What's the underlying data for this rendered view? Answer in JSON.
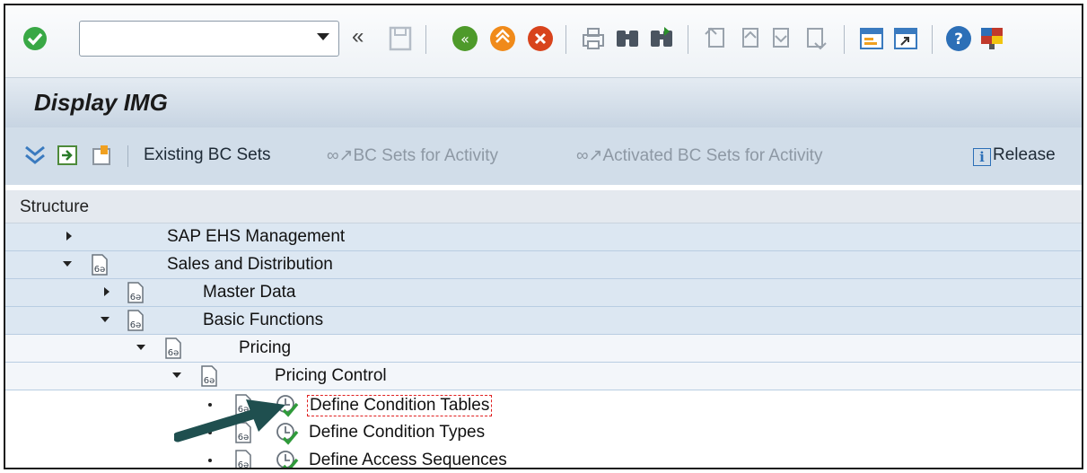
{
  "toolbar": {
    "command_field": {
      "value": "",
      "placeholder": ""
    },
    "icons": [
      "enter-icon",
      "back-nav-icon",
      "save-icon",
      "back-icon",
      "exit-icon",
      "cancel-icon",
      "print-icon",
      "find-icon",
      "find-next-icon",
      "first-page-icon",
      "previous-page-icon",
      "next-page-icon",
      "last-page-icon",
      "create-session-icon",
      "shortcut-icon",
      "help-icon",
      "layout-icon"
    ]
  },
  "title": "Display IMG",
  "app_toolbar": {
    "existing_bc_sets": "Existing BC Sets",
    "bc_sets_for_activity": "BC Sets for Activity",
    "activated_bc_sets": "Activated BC Sets for Activity",
    "release": "Release"
  },
  "tree": {
    "header": "Structure",
    "rows": [
      {
        "label": "SAP EHS Management"
      },
      {
        "label": "Sales and Distribution"
      },
      {
        "label": "Master Data"
      },
      {
        "label": "Basic Functions"
      },
      {
        "label": "Pricing"
      },
      {
        "label": "Pricing Control"
      },
      {
        "label": "Define Condition Tables"
      },
      {
        "label": "Define Condition Types"
      },
      {
        "label": "Define Access Sequences"
      }
    ]
  },
  "colors": {
    "selection_border": "#e02020",
    "arrow": "#1f4f4f",
    "tree_row_blue": "#dce7f2"
  }
}
